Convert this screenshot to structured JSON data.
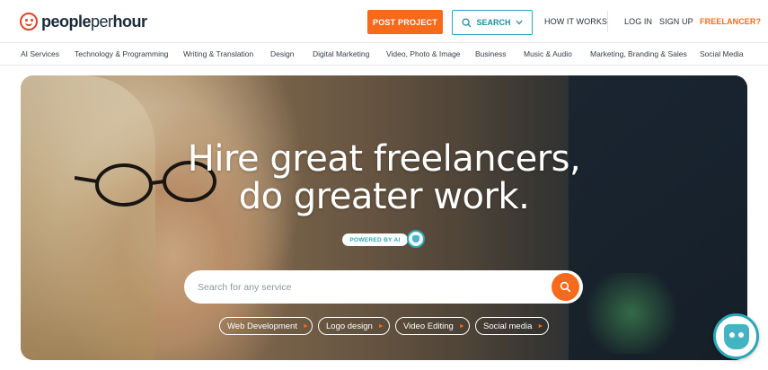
{
  "header": {
    "logo_bold": "people",
    "logo_thin": "per",
    "logo_bold2": "hour",
    "post_project": "POST PROJECT",
    "search": "SEARCH",
    "how_it_works": "HOW IT WORKS",
    "login": "LOG IN",
    "signup": "SIGN UP",
    "freelancer": "FREELANCER?"
  },
  "categories": [
    "AI Services",
    "Technology & Programming",
    "Writing & Translation",
    "Design",
    "Digital Marketing",
    "Video, Photo & Image",
    "Business",
    "Music & Audio",
    "Marketing, Branding & Sales",
    "Social Media"
  ],
  "hero": {
    "title_line1": "Hire great freelancers,",
    "title_line2": "do greater work.",
    "powered_by": "POWERED BY AI",
    "search_placeholder": "Search for any service",
    "chips": [
      "Web Development",
      "Logo design",
      "Video Editing",
      "Social media"
    ]
  },
  "colors": {
    "accent_orange": "#f76a1b",
    "accent_teal": "#2ba6b7",
    "logo_red": "#e4422c"
  }
}
